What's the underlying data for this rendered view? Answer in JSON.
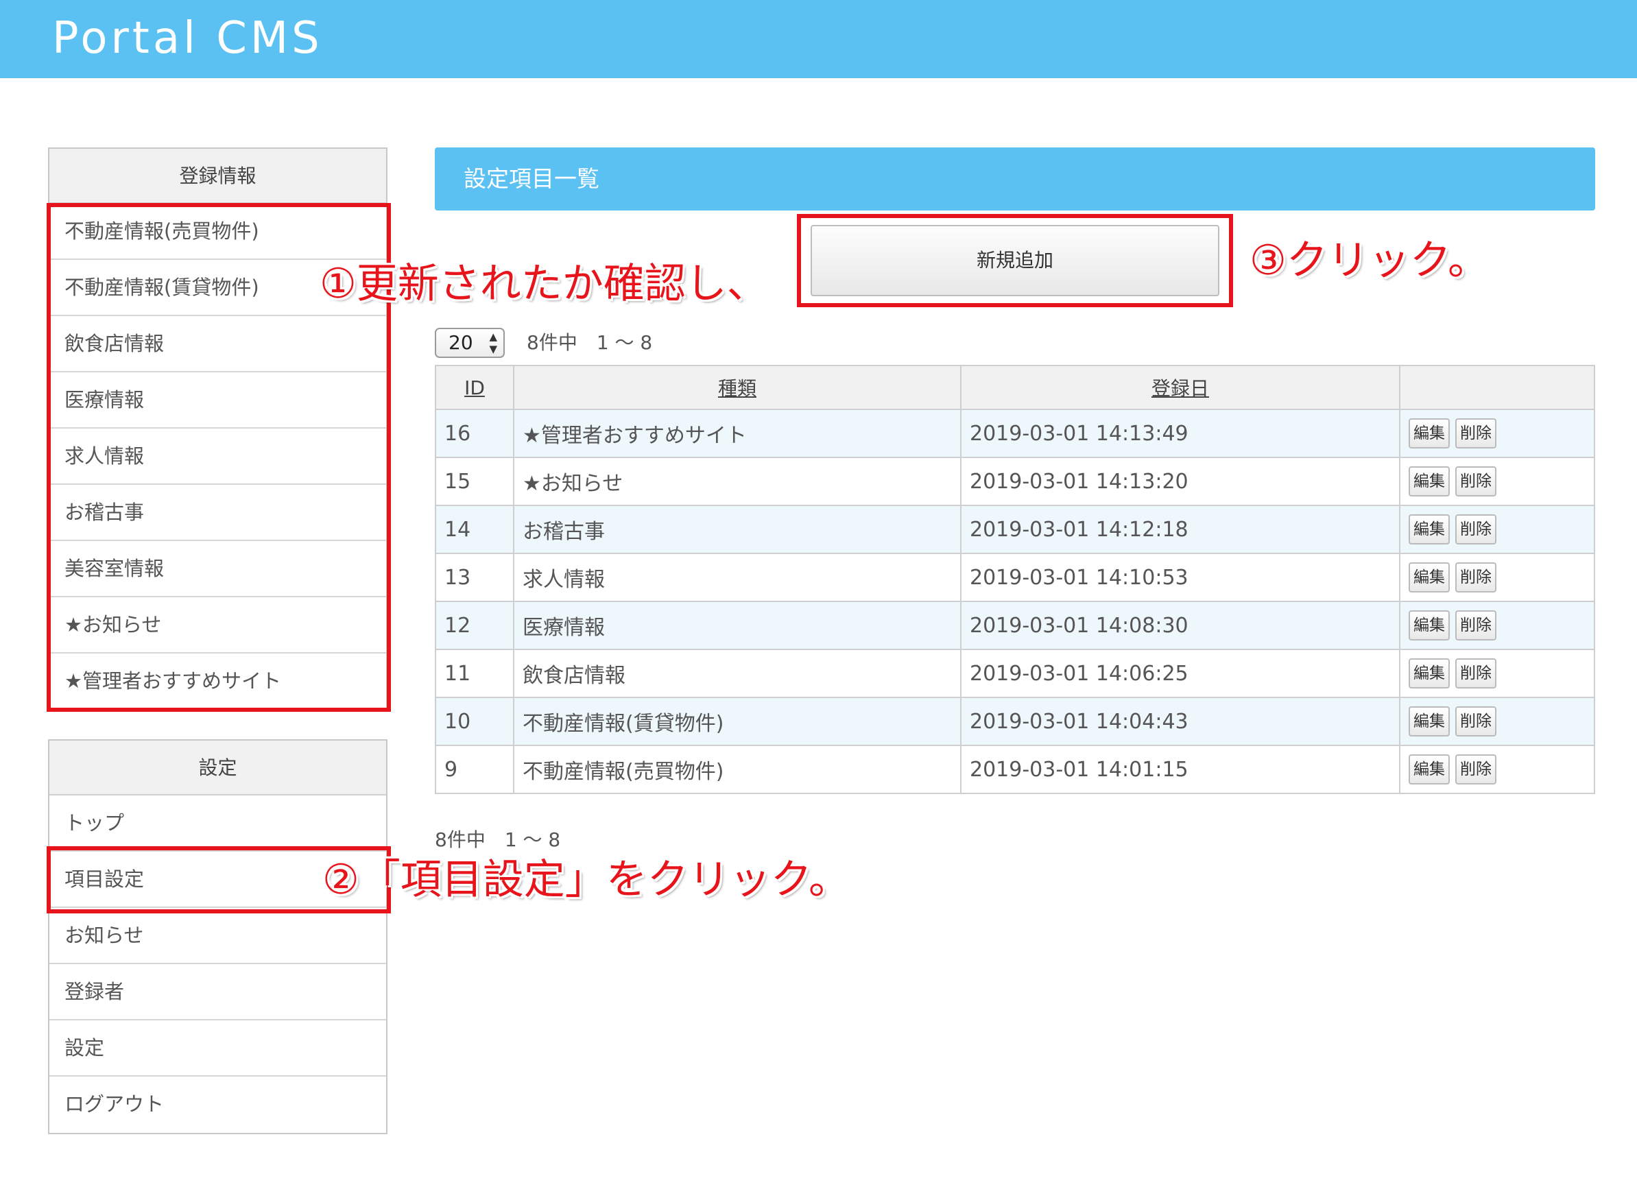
{
  "app_title": "Portal CMS",
  "sidebar": {
    "registration": {
      "heading": "登録情報",
      "items": [
        "不動産情報(売買物件)",
        "不動産情報(賃貸物件)",
        "飲食店情報",
        "医療情報",
        "求人情報",
        "お稽古事",
        "美容室情報",
        "★お知らせ",
        "★管理者おすすめサイト"
      ]
    },
    "settings": {
      "heading": "設定",
      "items": [
        "トップ",
        "項目設定",
        "お知らせ",
        "登録者",
        "設定",
        "ログアウト"
      ]
    }
  },
  "main": {
    "header": "設定項目一覧",
    "new_button": "新規追加",
    "per_page": "20",
    "count_text": "8件中　1 〜 8",
    "table": {
      "columns": [
        "ID",
        "種類",
        "登録日",
        ""
      ],
      "rows": [
        {
          "id": "16",
          "type": "★管理者おすすめサイト",
          "date": "2019-03-01 14:13:49"
        },
        {
          "id": "15",
          "type": "★お知らせ",
          "date": "2019-03-01 14:13:20"
        },
        {
          "id": "14",
          "type": "お稽古事",
          "date": "2019-03-01 14:12:18"
        },
        {
          "id": "13",
          "type": "求人情報",
          "date": "2019-03-01 14:10:53"
        },
        {
          "id": "12",
          "type": "医療情報",
          "date": "2019-03-01 14:08:30"
        },
        {
          "id": "11",
          "type": "飲食店情報",
          "date": "2019-03-01 14:06:25"
        },
        {
          "id": "10",
          "type": "不動産情報(賃貸物件)",
          "date": "2019-03-01 14:04:43"
        },
        {
          "id": "9",
          "type": "不動産情報(売買物件)",
          "date": "2019-03-01 14:01:15"
        }
      ],
      "edit_label": "編集",
      "delete_label": "削除"
    },
    "count_text_bottom": "8件中　1 〜 8"
  },
  "annotations": {
    "step1": "①更新されたか確認し、",
    "step2": "②「項目設定」をクリック。",
    "step3": "③クリック。"
  },
  "colors": {
    "accent": "#5bc1f2",
    "annotation_red": "#e8141b"
  }
}
